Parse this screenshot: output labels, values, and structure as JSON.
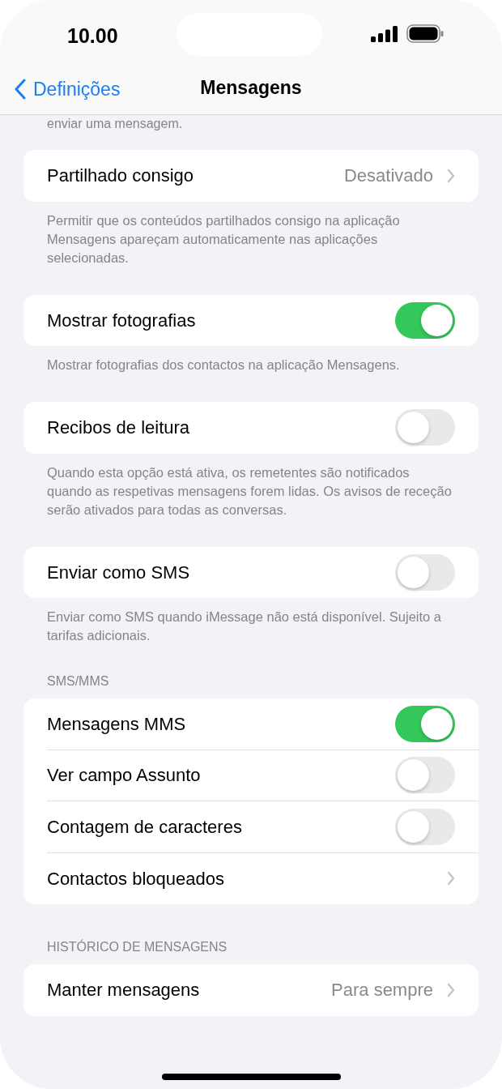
{
  "status_bar": {
    "time": "10.00"
  },
  "nav": {
    "back": "Definições",
    "title": "Mensagens"
  },
  "scrolled_text": "enviar uma mensagem.",
  "sections": [
    {
      "rows": [
        {
          "kind": "link",
          "label": "Partilhado consigo",
          "value": "Desativado"
        }
      ],
      "footer": "Permitir que os conteúdos partilhados consigo na aplicação Mensagens apareçam automaticamente nas aplicações selecionadas."
    },
    {
      "rows": [
        {
          "kind": "toggle",
          "label": "Mostrar fotografias",
          "on": true
        }
      ],
      "footer": "Mostrar fotografias dos contactos na aplicação Mensagens."
    },
    {
      "rows": [
        {
          "kind": "toggle",
          "label": "Recibos de leitura",
          "on": false
        }
      ],
      "footer": "Quando esta opção está ativa, os remetentes são notificados quando as respetivas mensagens forem lidas. Os avisos de receção serão ativados para todas as conversas."
    },
    {
      "rows": [
        {
          "kind": "toggle",
          "label": "Enviar como SMS",
          "on": false
        }
      ],
      "footer": "Enviar como SMS quando iMessage não está disponível. Sujeito a tarifas adicionais."
    },
    {
      "header": "SMS/MMS",
      "rows": [
        {
          "kind": "toggle",
          "label": "Mensagens MMS",
          "on": true
        },
        {
          "kind": "toggle",
          "label": "Ver campo Assunto",
          "on": false
        },
        {
          "kind": "toggle",
          "label": "Contagem de caracteres",
          "on": false
        },
        {
          "kind": "link",
          "label": "Contactos bloqueados"
        }
      ]
    },
    {
      "header": "HISTÓRICO DE MENSAGENS",
      "rows": [
        {
          "kind": "link",
          "label": "Manter mensagens",
          "value": "Para sempre"
        }
      ]
    }
  ]
}
